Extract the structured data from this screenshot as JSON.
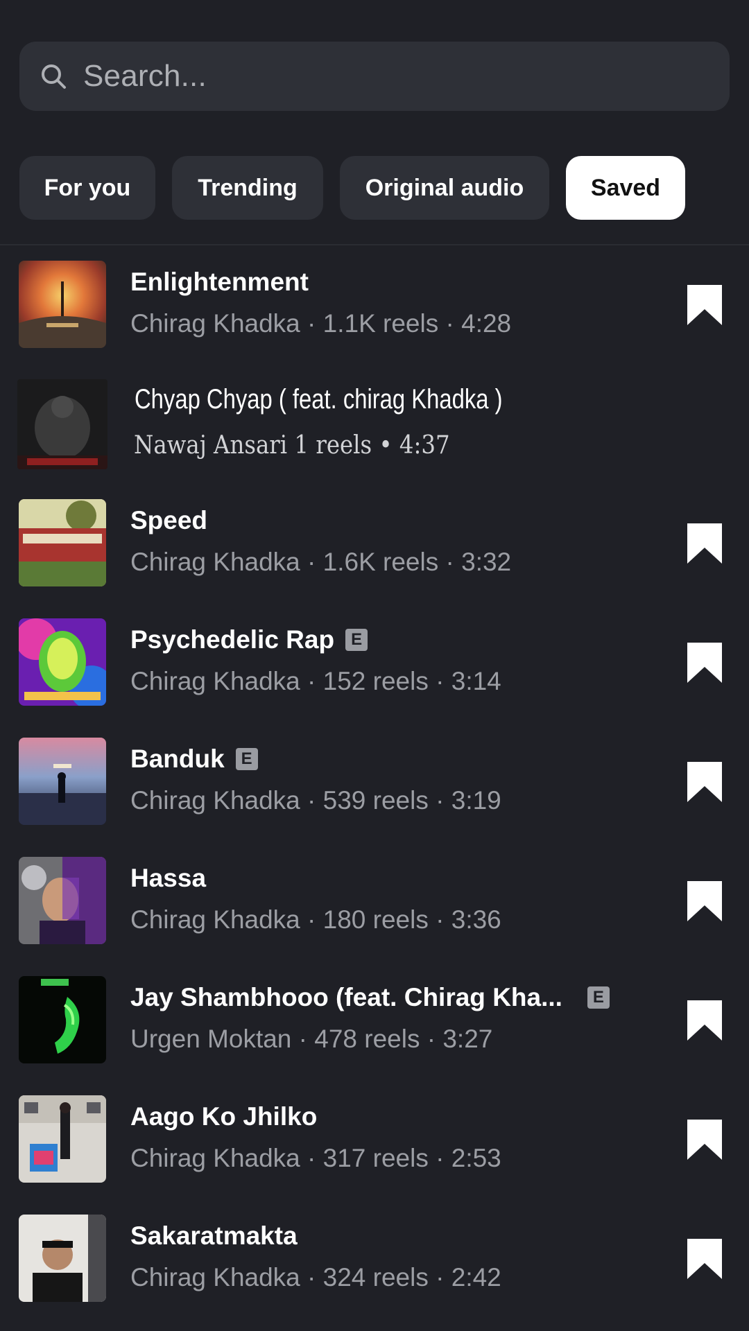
{
  "search": {
    "placeholder": "Search...",
    "icon": "search-icon"
  },
  "tabs": [
    {
      "label": "For you",
      "active": false
    },
    {
      "label": "Trending",
      "active": false
    },
    {
      "label": "Original audio",
      "active": false
    },
    {
      "label": "Saved",
      "active": true
    }
  ],
  "songs": [
    {
      "title": "Enlightenment",
      "meta": "Chirag Khadka · 1.1K reels · 4:28",
      "explicit": false,
      "saved": true
    },
    {
      "title": "Chyap Chyap ( feat. chirag Khadka )",
      "meta": "Nawaj Ansari 1 reels • 4:37",
      "explicit": false,
      "saved": false
    },
    {
      "title": "Speed",
      "meta": "Chirag Khadka · 1.6K reels · 3:32",
      "explicit": false,
      "saved": true
    },
    {
      "title": "Psychedelic Rap",
      "meta": "Chirag Khadka · 152 reels · 3:14",
      "explicit": true,
      "saved": true
    },
    {
      "title": "Banduk",
      "meta": "Chirag Khadka · 539 reels · 3:19",
      "explicit": true,
      "saved": true
    },
    {
      "title": "Hassa",
      "meta": "Chirag Khadka · 180 reels · 3:36",
      "explicit": false,
      "saved": true
    },
    {
      "title": "Jay Shambhooo (feat. Chirag Kha...",
      "meta": "Urgen Moktan · 478 reels · 3:27",
      "explicit": true,
      "saved": true
    },
    {
      "title": "Aago Ko Jhilko",
      "meta": "Chirag Khadka · 317 reels · 2:53",
      "explicit": false,
      "saved": true
    },
    {
      "title": "Sakaratmakta",
      "meta": "Chirag Khadka · 324 reels · 2:42",
      "explicit": false,
      "saved": true
    }
  ],
  "explicit_badge": "E",
  "colors": {
    "background": "#1f2026",
    "surface": "#2e3037",
    "active_tab": "#ffffff",
    "secondary_text": "#9c9ea4"
  }
}
